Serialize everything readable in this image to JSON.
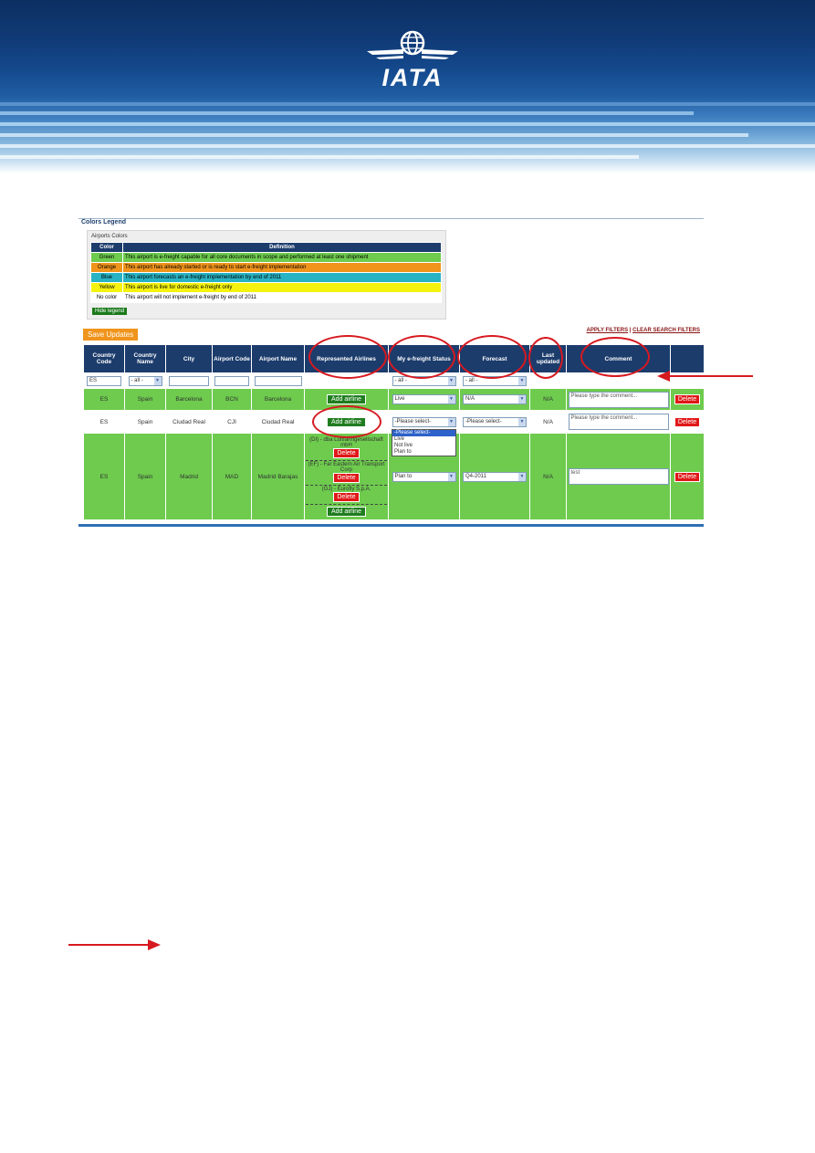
{
  "brand": {
    "name": "IATA"
  },
  "legend": {
    "title": "Colors Legend",
    "subtitle": "Airports Colors",
    "col_color": "Color",
    "col_definition": "Definition",
    "rows": [
      {
        "color": "Green",
        "definition": "This airport is e-freight capable for all core documents in scope and performed at least one shipment",
        "bg": "#6ecb4e"
      },
      {
        "color": "Orange",
        "definition": "This airport has already started or is ready to start e-freight implementation",
        "bg": "#f0941c"
      },
      {
        "color": "Blue",
        "definition": "This airport forecasts an e-freight implementation by end of 2011",
        "bg": "#28b3c4"
      },
      {
        "color": "Yellow",
        "definition": "This airport is live for domestic e-freight only",
        "bg": "#f4f20e"
      },
      {
        "color": "No color",
        "definition": "This airport will not implement e-freight by end of 2011",
        "bg": "#ffffff"
      }
    ],
    "hide_label": "Hide legend"
  },
  "toolbar": {
    "save_label": "Save Updates",
    "apply_filters": "APPLY FILTERS",
    "separator": "|",
    "clear_filters": "CLEAR SEARCH FILTERS"
  },
  "columns": {
    "country_code": "Country Code",
    "country_name": "Country Name",
    "city": "City",
    "airport_code": "Airport Code",
    "airport_name": "Airport Name",
    "airlines": "Represented Airlines",
    "status": "My e-freight Status",
    "forecast": "Forecast",
    "last_updated": "Last updated",
    "comment": "Comment"
  },
  "filters": {
    "country_code": "ES",
    "country_name": "- all -",
    "status": "- all -",
    "forecast": "- all -"
  },
  "rows": [
    {
      "country_code": "ES",
      "country_name": "Spain",
      "city": "Barcelona",
      "airport_code": "BCN",
      "airport_name": "Barcelona",
      "add_label": "Add airline",
      "status": "Live",
      "forecast": "N/A",
      "last_updated": "N/A",
      "comment_placeholder": "Please type the comment...",
      "delete_label": "Delete"
    },
    {
      "country_code": "ES",
      "country_name": "Spain",
      "city": "Ciudad Real",
      "airport_code": "CJI",
      "airport_name": "Ciudad Real",
      "add_label": "Add airline",
      "status": "-Please select-",
      "forecast": "-Please select-",
      "last_updated": "N/A",
      "comment_placeholder": "Please type the comment...",
      "delete_label": "Delete"
    },
    {
      "country_code": "ES",
      "country_name": "Spain",
      "city": "Madrid",
      "airport_code": "MAD",
      "airport_name": "Madrid Barajas",
      "airlines": [
        {
          "name": "(DI) - dba Luftfahrtgesellschaft mbH",
          "delete_label": "Delete"
        },
        {
          "name": "(EF) - Far Eastern Air Transport Corp",
          "delete_label": "Delete"
        },
        {
          "name": "(GJ) - Eurofly S.p.A.",
          "delete_label": "Delete"
        }
      ],
      "add_label": "Add airline",
      "status": "Plan to",
      "forecast": "Q4-2011",
      "last_updated": "N/A",
      "comment": "test",
      "delete_label": "Delete"
    }
  ],
  "status_dropdown": {
    "options": [
      "-Please select-",
      "Live",
      "Not live",
      "Plan to"
    ]
  },
  "annotations": {
    "color": "#d71920"
  }
}
